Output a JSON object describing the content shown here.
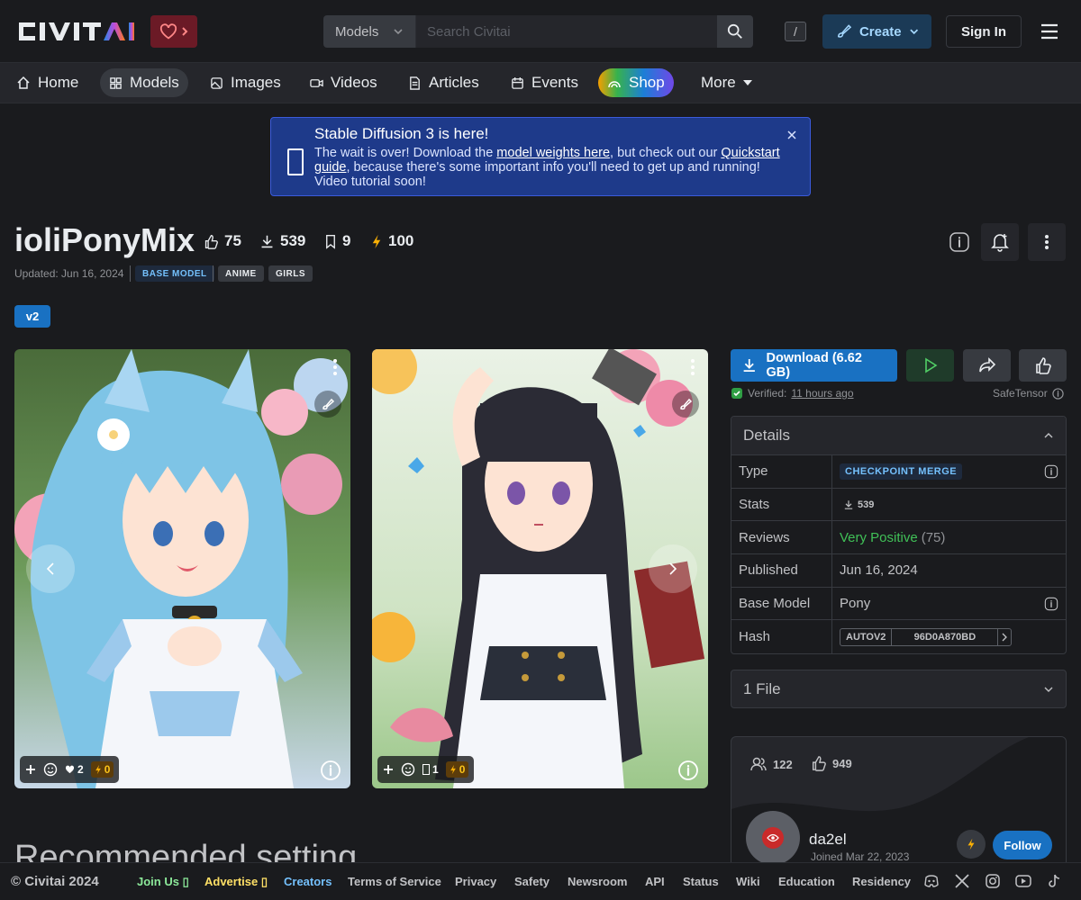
{
  "header": {
    "logo_text": "CIVITAI",
    "search_select": "Models",
    "search_placeholder": "Search Civitai",
    "search_shortcut": "/",
    "create_label": "Create",
    "signin_label": "Sign In"
  },
  "nav": {
    "items": [
      {
        "label": "Home",
        "icon": "home-icon"
      },
      {
        "label": "Models",
        "icon": "grid-icon"
      },
      {
        "label": "Images",
        "icon": "photo-icon"
      },
      {
        "label": "Videos",
        "icon": "video-icon"
      },
      {
        "label": "Articles",
        "icon": "file-text-icon"
      },
      {
        "label": "Events",
        "icon": "calendar-icon"
      },
      {
        "label": "Shop",
        "icon": "rainbow-icon"
      },
      {
        "label": "More",
        "icon": "caret-down-icon"
      }
    ]
  },
  "banner": {
    "title": "Stable Diffusion 3 is here!",
    "text_1": "The wait is over! Download the ",
    "link_1": "model weights here",
    "text_2": ", but check out our ",
    "link_2": "Quickstart guide",
    "text_3": ", because there's some important info you'll need to get up and running! Video tutorial soon!"
  },
  "model": {
    "title": "ioliPonyMix",
    "likes": "75",
    "downloads": "539",
    "bookmarks": "9",
    "buzz": "100",
    "updated": "Updated: Jun 16, 2024",
    "tags": [
      "BASE MODEL",
      "ANIME",
      "GIRLS"
    ],
    "version": "v2"
  },
  "gallery": {
    "cards": [
      {
        "hearts": "2",
        "buzz": "0"
      },
      {
        "cries": "1",
        "buzz": "0"
      }
    ]
  },
  "download": {
    "label": "Download (6.62 GB)",
    "verified_prefix": "Verified: ",
    "verified_time": "11 hours ago",
    "format": "SafeTensor"
  },
  "details": {
    "heading": "Details",
    "rows": [
      {
        "key": "Type",
        "value": "CHECKPOINT MERGE"
      },
      {
        "key": "Stats",
        "value": "539"
      },
      {
        "key": "Reviews",
        "value": "Very Positive",
        "extra": "(75)"
      },
      {
        "key": "Published",
        "value": "Jun 16, 2024"
      },
      {
        "key": "Base Model",
        "value": "Pony"
      },
      {
        "key": "Hash",
        "value": "AUTOV2",
        "hash": "96D0A870BD"
      }
    ]
  },
  "files": {
    "label": "1 File"
  },
  "creator": {
    "followers": "122",
    "likes": "949",
    "name": "da2el",
    "joined": "Joined Mar 22, 2023",
    "follow_label": "Follow"
  },
  "recommended_heading": "Recommended setting",
  "footer": {
    "copyright": "© Civitai 2024",
    "links": [
      "Join Us",
      "Advertise",
      "Creators",
      "Terms of Service",
      "Privacy",
      "Safety",
      "Newsroom",
      "API",
      "Status",
      "Wiki",
      "Education",
      "Residency"
    ]
  },
  "colors": {
    "primary": "#1971c2",
    "background": "#1a1b1e",
    "panel": "#25262b",
    "buzz": "#fab005",
    "positive": "#40c057"
  }
}
